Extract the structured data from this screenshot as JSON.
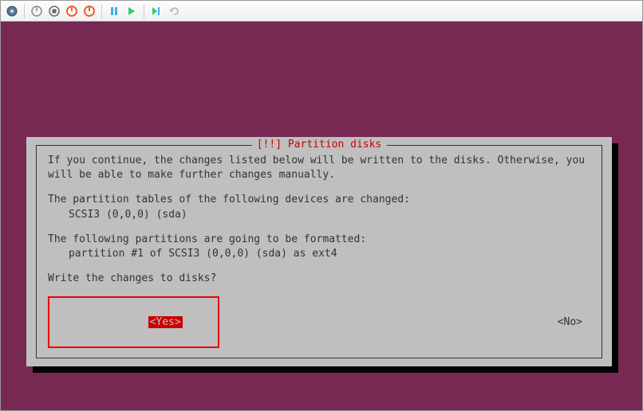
{
  "toolbar": {
    "icons": [
      "settings",
      "power1",
      "stop",
      "power-orange1",
      "power-orange2",
      "pause",
      "play",
      "step",
      "undo"
    ]
  },
  "dialog": {
    "title": "[!!] Partition disks",
    "line1": "If you continue, the changes listed below will be written to the disks. Otherwise, you will be able to make further changes manually.",
    "line2": "The partition tables of the following devices are changed:",
    "line2a": "SCSI3 (0,0,0) (sda)",
    "line3": "The following partitions are going to be formatted:",
    "line3a": "partition #1 of SCSI3 (0,0,0) (sda) as ext4",
    "prompt": "Write the changes to disks?",
    "yes": "<Yes>",
    "no": "<No>"
  }
}
